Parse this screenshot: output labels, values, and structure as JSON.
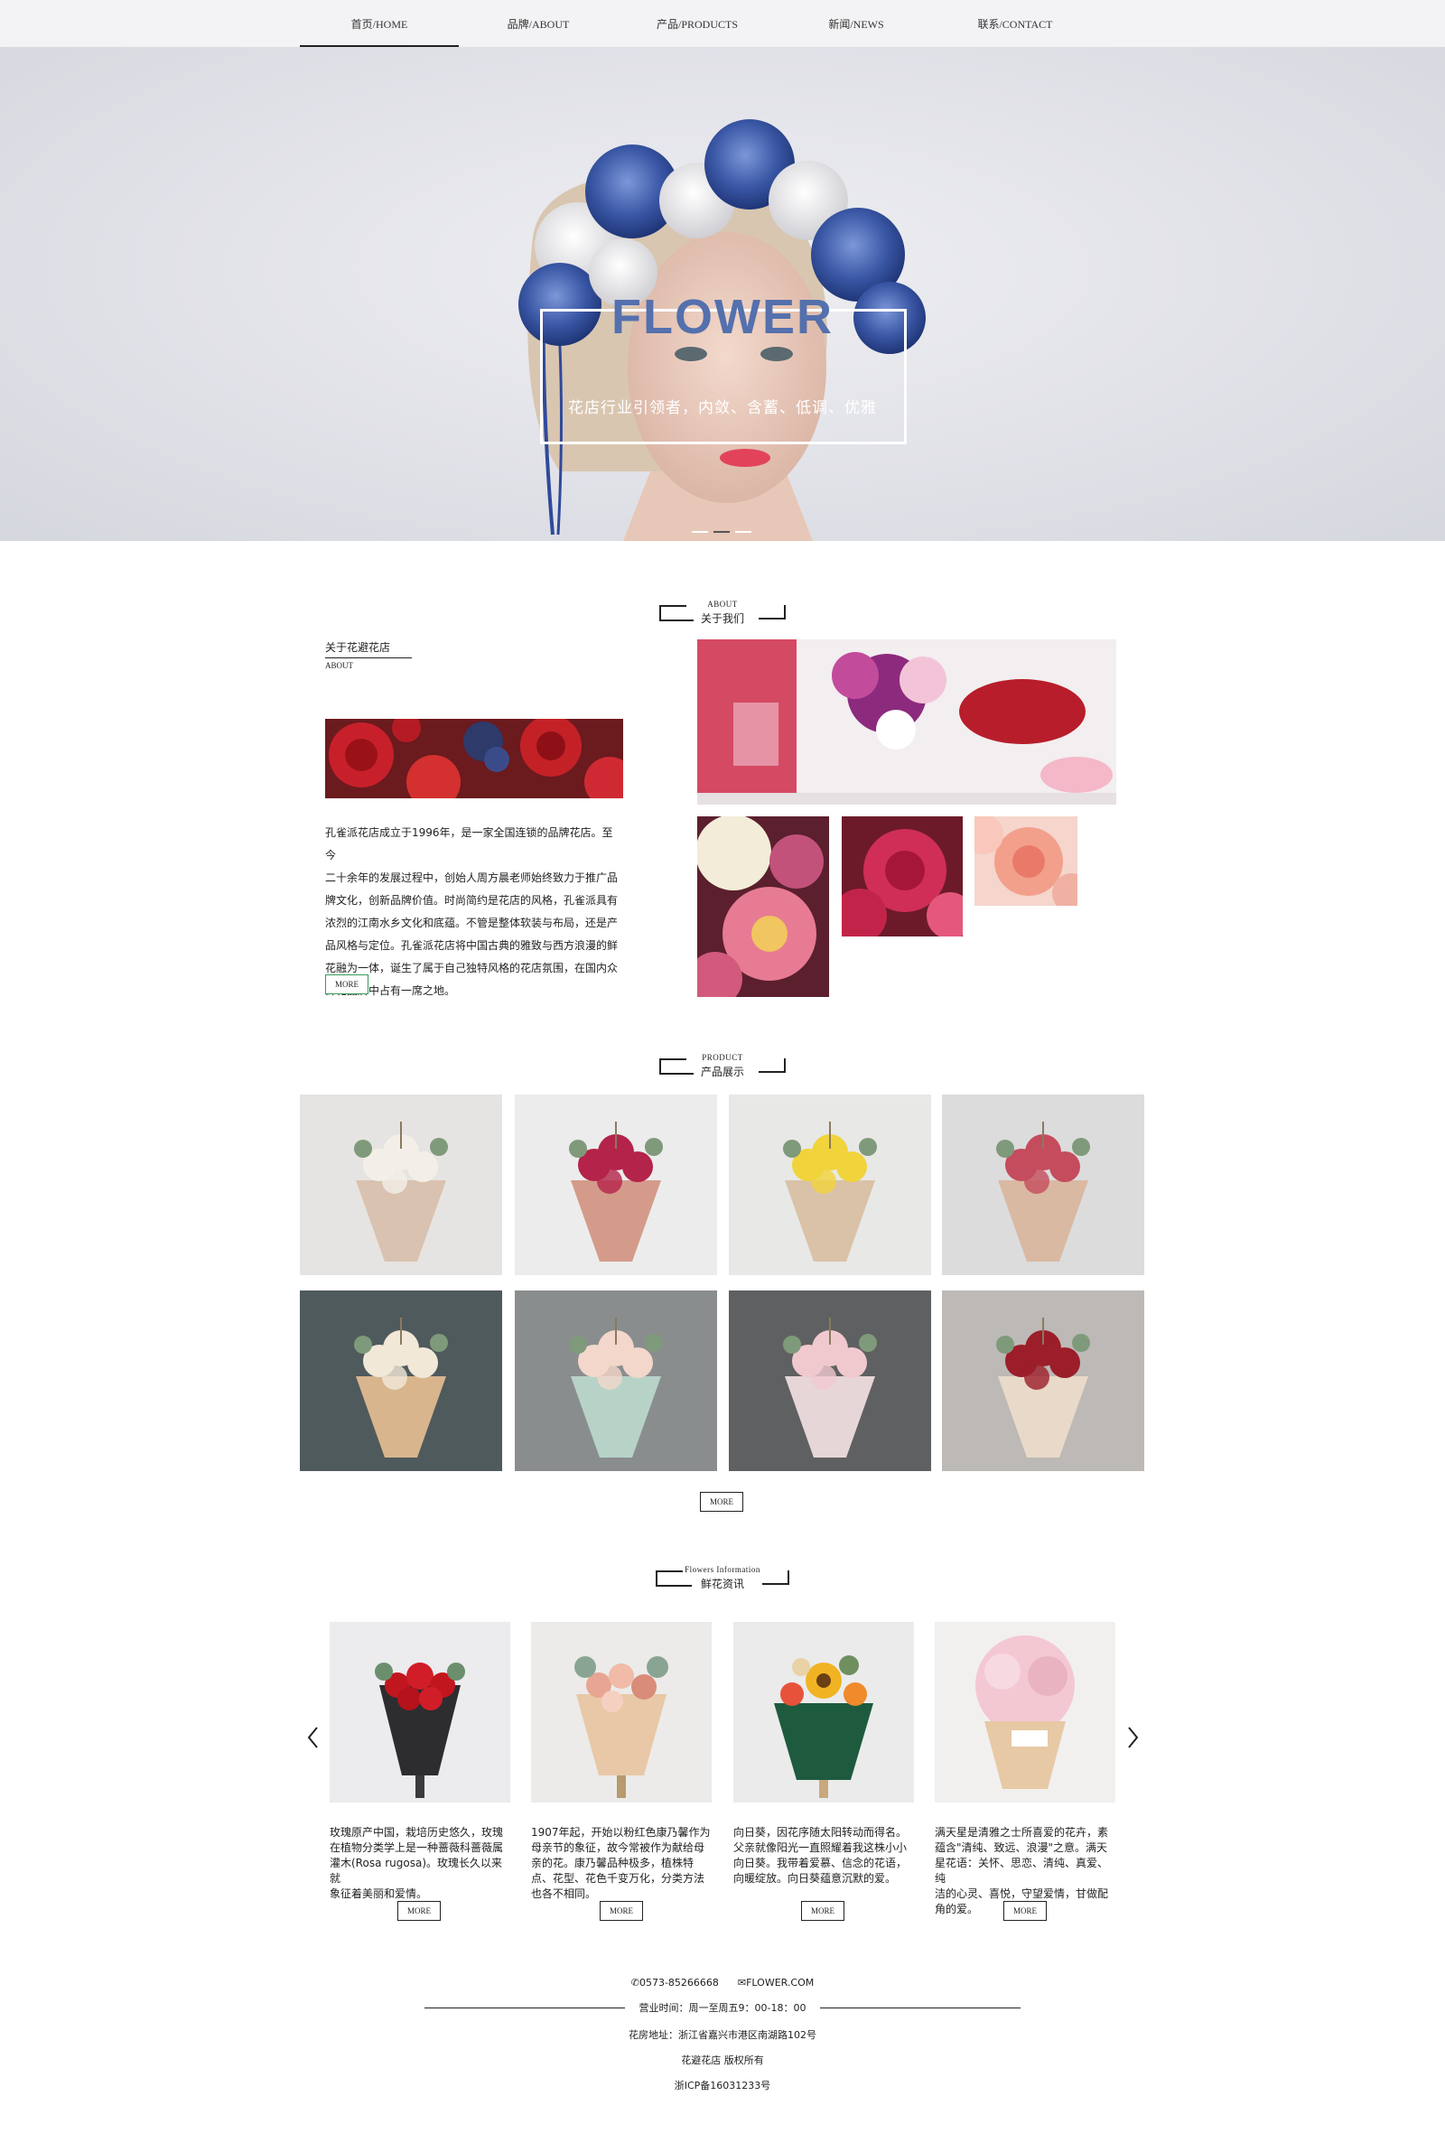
{
  "nav": {
    "items": [
      {
        "label": "首页/HOME"
      },
      {
        "label": "品牌/ABOUT"
      },
      {
        "label": "产品/PRODUCTS"
      },
      {
        "label": "新闻/NEWS"
      },
      {
        "label": "联系/CONTACT"
      }
    ],
    "active_index": 0
  },
  "hero": {
    "title": "FLOWER",
    "subtitle": "花店行业引领者，内敛、含蓄、低调、优雅",
    "slide_count": 3,
    "active_slide": 1,
    "title_color": "#5470ad"
  },
  "about": {
    "heading_en": "ABOUT",
    "heading_cn": "关于我们",
    "title_cn": "关于花避花店",
    "title_en": "ABOUT",
    "lines": [
      "孔雀派花店成立于1996年，是一家全国连锁的品牌花店。至今",
      "二十余年的发展过程中，创始人周方晨老师始终致力于推广品",
      "牌文化，创新品牌价值。时尚简约是花店的风格，孔雀派具有",
      "浓烈的江南水乡文化和底蕴。不管是整体软装与布局，还是产",
      "品风格与定位。孔雀派花店将中国古典的雅致与西方浪漫的鲜",
      "花融为一体，诞生了属于自己独特风格的花店氛围，在国内众",
      "鲜花品牌中占有一席之地。"
    ],
    "more_label": "MORE"
  },
  "product": {
    "heading_en": "PRODUCT",
    "heading_cn": "产品展示",
    "more_label": "MORE"
  },
  "news": {
    "heading_en": "Flowers Information",
    "heading_cn": "鲜花资讯",
    "items": [
      {
        "lines": [
          "玫瑰原产中国，栽培历史悠久，玫瑰",
          "在植物分类学上是一种蔷薇科蔷薇属",
          "灌木(Rosa rugosa)。玫瑰长久以来就",
          "象征着美丽和爱情。"
        ],
        "more": "MORE"
      },
      {
        "lines": [
          "1907年起，开始以粉红色康乃馨作为",
          "母亲节的象征，故今常被作为献给母",
          "亲的花。康乃馨品种极多，植株特",
          "点、花型、花色千变万化，分类方法",
          "也各不相同。"
        ],
        "more": "MORE"
      },
      {
        "lines": [
          "向日葵，因花序随太阳转动而得名。",
          "父亲就像阳光一直照耀着我这株小小",
          "向日葵。我带着爱慕、信念的花语，",
          "向暖绽放。向日葵蕴意沉默的爱。"
        ],
        "more": "MORE"
      },
      {
        "lines": [
          "满天星是清雅之士所喜爱的花卉，素",
          "蕴含\"清纯、致远、浪漫\"之意。满天",
          "星花语：关怀、思恋、清纯、真爱、纯",
          "洁的心灵、喜悦，守望爱情，甘做配",
          "角的爱。"
        ],
        "more": "MORE"
      }
    ]
  },
  "footer": {
    "phone": "0573-85266668",
    "email": "FLOWER.COM",
    "hours": "营业时间：周一至周五9：00-18：00",
    "address": "花房地址：浙江省嘉兴市港区南湖路102号",
    "copyright": "花避花店  版权所有",
    "icp": "浙ICP备16031233号"
  }
}
